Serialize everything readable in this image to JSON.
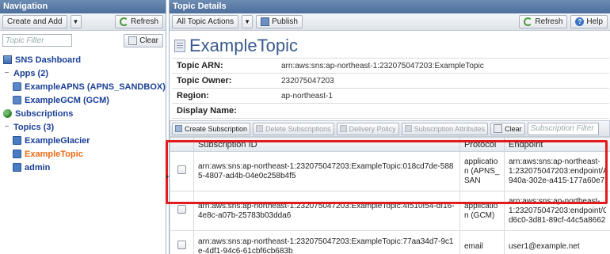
{
  "navigation": {
    "header": "Navigation",
    "create_add_label": "Create and Add",
    "refresh_label": "Refresh",
    "filter_placeholder": "Topic Filter",
    "clear_label": "Clear",
    "tree": {
      "dashboard": "SNS Dashboard",
      "apps": "Apps (2)",
      "app_1": "ExampleAPNS (APNS_SANDBOX)",
      "app_2": "ExampleGCM (GCM)",
      "subscriptions": "Subscriptions",
      "topics": "Topics (3)",
      "topic_1": "ExampleGlacier",
      "topic_2": "ExampleTopic",
      "topic_3": "admin"
    }
  },
  "details": {
    "header": "Topic Details",
    "all_actions_label": "All Topic Actions",
    "publish_label": "Publish",
    "refresh_label": "Refresh",
    "help_label": "Help",
    "title": "ExampleTopic",
    "props": {
      "arn_key": "Topic ARN:",
      "arn_val": "arn:aws:sns:ap-northeast-1:232075047203:ExampleTopic",
      "owner_key": "Topic Owner:",
      "owner_val": "232075047203",
      "region_key": "Region:",
      "region_val": "ap-northeast-1",
      "display_key": "Display Name:",
      "display_val": ""
    },
    "subs_toolbar": {
      "create": "Create Subscription",
      "delete": "Delete Subscriptions",
      "delivery": "Delivery Policy",
      "attributes": "Subscription Attributes",
      "clear": "Clear",
      "filter_placeholder": "Subscription Filter"
    },
    "columns": {
      "id": "Subscription ID",
      "protocol": "Protocol",
      "endpoint": "Endpoint"
    },
    "rows": [
      {
        "id": "arn:aws:sns:ap-northeast-1:232075047203:ExampleTopic:018cd7de-5885-4807-ad4b-04e0c258b4f5",
        "protocol": "application (APNS_SAN",
        "endpoint_1": "arn:aws:sns:ap-northeast-",
        "endpoint_2": "1:232075047203:endpoint/A",
        "endpoint_3": "940a-302e-a415-177a60e7"
      },
      {
        "id": "arn:aws:sns:ap-northeast-1:232075047203:ExampleTopic:4f510f54-df16-4e8c-a07b-25783b03dda6",
        "protocol": "application (GCM)",
        "endpoint_1": "arn:aws:sns:ap-northeast-",
        "endpoint_2": "1:232075047203:endpoint/G",
        "endpoint_3": "d6c0-3d81-89cf-44c5a8662"
      },
      {
        "id": "arn:aws:sns:ap-northeast-1:232075047203:ExampleTopic:77aa34d7-9c1e-4df1-94c6-61cbf6cb683b",
        "protocol": "email",
        "endpoint_1": "user1@example.net",
        "endpoint_2": "",
        "endpoint_3": ""
      }
    ]
  }
}
